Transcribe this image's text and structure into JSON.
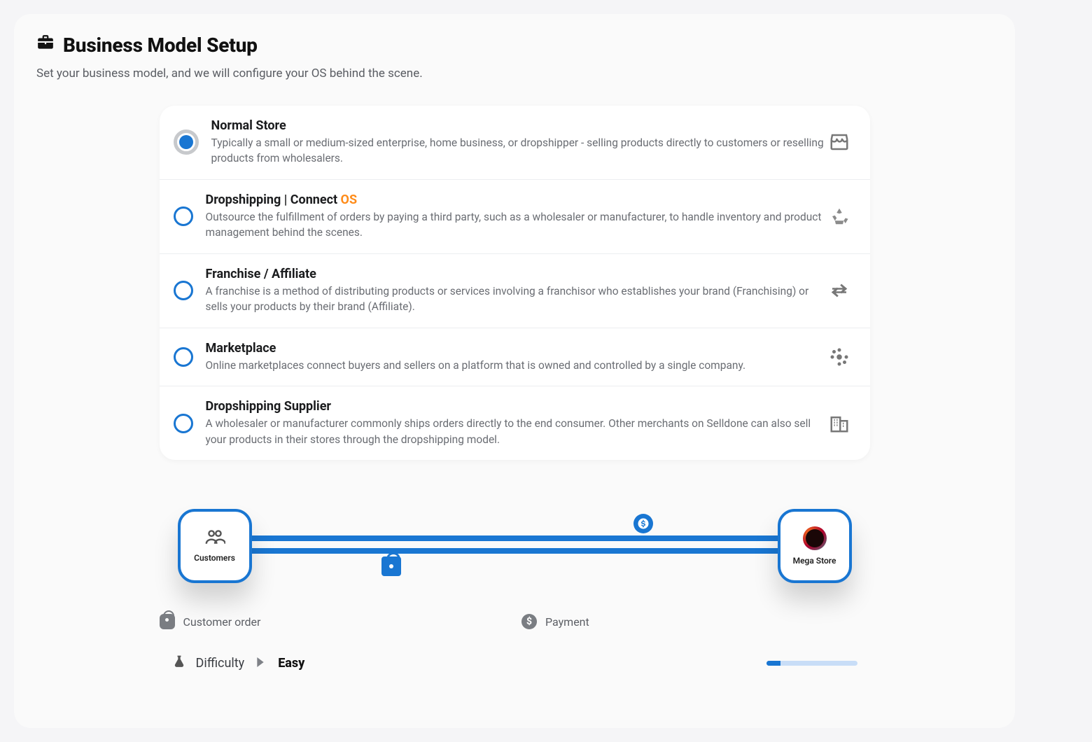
{
  "header": {
    "title": "Business Model Setup",
    "subtitle": "Set your business model, and we will configure your OS behind the scene."
  },
  "options": [
    {
      "title": "Normal Store",
      "badge": "",
      "selected": true,
      "desc": "Typically a small or medium-sized enterprise, home business, or dropshipper - selling products directly to customers or reselling products from wholesalers."
    },
    {
      "title": "Dropshipping | Connect ",
      "badge": "OS",
      "selected": false,
      "desc": "Outsource the fulfillment of orders by paying a third party, such as a wholesaler or manufacturer, to handle inventory and product management behind the scenes."
    },
    {
      "title": "Franchise / Affiliate",
      "badge": "",
      "selected": false,
      "desc": "A franchise is a method of distributing products or services involving a franchisor who establishes your brand (Franchising) or sells your products by their brand (Affiliate)."
    },
    {
      "title": "Marketplace",
      "badge": "",
      "selected": false,
      "desc": "Online marketplaces connect buyers and sellers on a platform that is owned and controlled by a single company."
    },
    {
      "title": "Dropshipping Supplier",
      "badge": "",
      "selected": false,
      "desc": "A wholesaler or manufacturer commonly ships orders directly to the end consumer. Other merchants on Selldone can also sell your products in their stores through the dropshipping model."
    }
  ],
  "diagram": {
    "left_label": "Customers",
    "right_label": "Mega Store"
  },
  "legend": {
    "order": "Customer order",
    "payment": "Payment"
  },
  "difficulty": {
    "label": "Difficulty",
    "value": "Easy",
    "progress_percent": 16
  }
}
